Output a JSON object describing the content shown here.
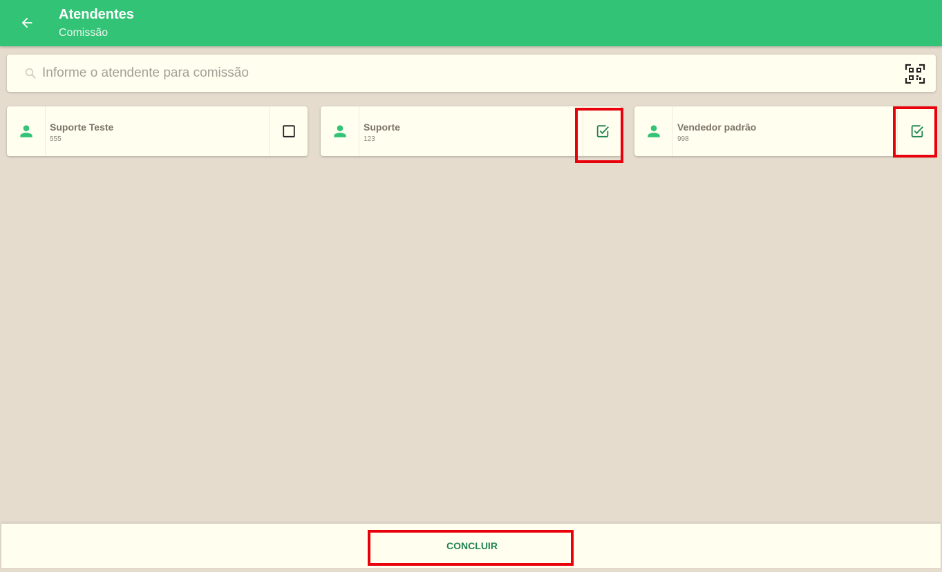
{
  "header": {
    "title": "Atendentes",
    "subtitle": "Comissão",
    "back_icon": "arrow-left-icon"
  },
  "search": {
    "placeholder": "Informe o atendente para comissão",
    "value": "",
    "icon": "search-icon",
    "qr_icon": "qr-code-scanner-icon"
  },
  "attendants": [
    {
      "name": "Suporte Teste",
      "code": "555",
      "checked": false
    },
    {
      "name": "Suporte",
      "code": "123",
      "checked": true
    },
    {
      "name": "Vendedor padrão",
      "code": "998",
      "checked": true
    }
  ],
  "footer": {
    "button_label": "CONCLUIR"
  },
  "colors": {
    "primary": "#33c377",
    "accent_dark": "#20844f",
    "background": "#e5dccd",
    "card": "#fffeef",
    "highlight": "#e8000b"
  }
}
